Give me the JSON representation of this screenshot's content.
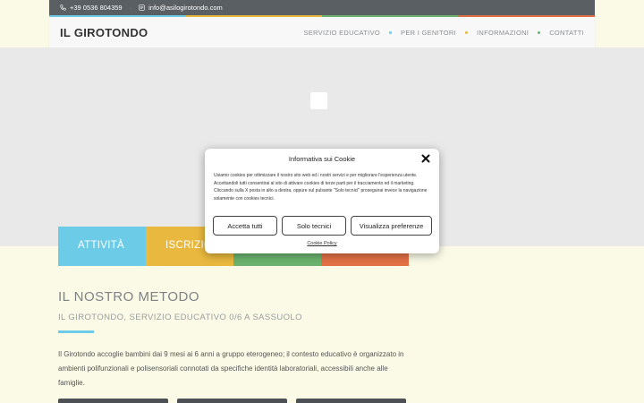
{
  "topbar": {
    "phone": "+39 0536 804359",
    "email": "info@asilogirotondo.com",
    "phone_icon": "phone-icon",
    "email_icon": "email-icon"
  },
  "header": {
    "logo": "IL GIROTONDO",
    "nav": [
      {
        "label": "SERVIZIO EDUCATIVO"
      },
      {
        "label": "PER I GENITORI"
      },
      {
        "label": "INFORMAZIONI"
      },
      {
        "label": "CONTATTI"
      }
    ],
    "nav_dot_colors": [
      "#6ccbe6",
      "#e9b93f",
      "#6bb36e"
    ]
  },
  "tabs": [
    {
      "label": "ATTIVITÀ",
      "color": "#6ccbe6"
    },
    {
      "label": "ISCRIZIONI",
      "color": "#e9b93f"
    },
    {
      "label": "",
      "color": "#6bb36e"
    },
    {
      "label": "",
      "color": "#e37045"
    }
  ],
  "section": {
    "title": "IL NOSTRO METODO",
    "subtitle": "IL GIROTONDO, SERVIZIO EDUCATIVO 0/6 A SASSUOLO",
    "intro": "Il Girotondo accoglie bambini dai 9 mesi ai 6 anni a gruppo eterogeneo; il contesto educativo è organizzato in ambienti polifunzionali e polisensoriali connotati da specifiche identità laboratoriali, accessibili anche alle famiglie."
  },
  "cookie": {
    "title": "Informativa sui Cookie",
    "body": "Usiamo cookies per ottimizzare il nostro sito web ed i nostri servizi e per migliorare l'esperienza utente. Accettandoli tutti consentirai al sito di attivare cookies di terze parti per il tracciamento ed il marketing. Cliccando sulla X posta in alto a destra, oppure sul pulsante \"Solo tecnici\" proseguirai invece la navigazione solamente con cookies tecnici.",
    "accept_all": "Accetta tutti",
    "only_technical": "Solo tecnici",
    "preferences": "Visualizza preferenze",
    "policy_link": "Cookie Policy"
  }
}
